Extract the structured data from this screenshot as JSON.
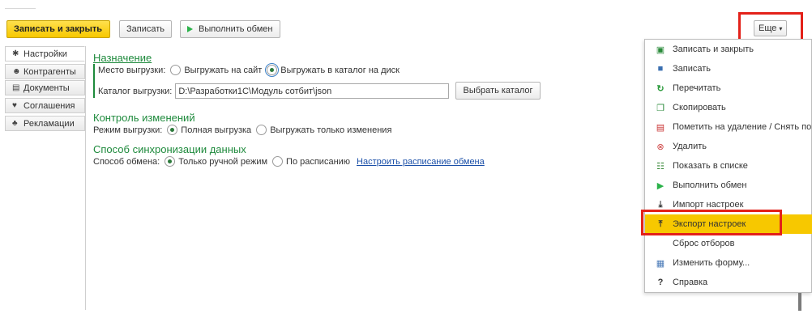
{
  "toolbar": {
    "save_close": "Записать и закрыть",
    "save": "Записать",
    "run_exchange": "Выполнить обмен",
    "more": "Еще"
  },
  "tabs": [
    {
      "label": "Настройки",
      "icon": "gear-icon"
    },
    {
      "label": "Контрагенты",
      "icon": "people-icon"
    },
    {
      "label": "Документы",
      "icon": "document-icon"
    },
    {
      "label": "Соглашения",
      "icon": "handshake-icon"
    },
    {
      "label": "Рекламации",
      "icon": "claims-icon"
    }
  ],
  "destination": {
    "title": "Назначение",
    "place_label": "Место выгрузки:",
    "option_site": "Выгружать на сайт",
    "option_disk": "Выгружать в каталог на диск",
    "folder_label": "Каталог выгрузки:",
    "folder_value": "D:\\Разработки1С\\Модуль сотбит\\json",
    "choose_folder": "Выбрать каталог"
  },
  "changes": {
    "title": "Контроль изменений",
    "mode_label": "Режим выгрузки:",
    "option_full": "Полная выгрузка",
    "option_changes": "Выгружать только изменения"
  },
  "sync": {
    "title": "Способ синхронизации данных",
    "method_label": "Способ обмена:",
    "option_manual": "Только ручной режим",
    "option_schedule": "По расписанию",
    "schedule_link": "Настроить расписание обмена"
  },
  "menu": {
    "items": [
      {
        "label": "Записать и закрыть",
        "icon": "save-close-icon"
      },
      {
        "label": "Записать",
        "icon": "save-icon"
      },
      {
        "label": "Перечитать",
        "icon": "refresh-icon"
      },
      {
        "label": "Скопировать",
        "icon": "copy-icon"
      },
      {
        "label": "Пометить на удаление / Снять по",
        "icon": "mark-delete-icon"
      },
      {
        "label": "Удалить",
        "icon": "delete-icon"
      },
      {
        "label": "Показать в списке",
        "icon": "show-in-list-icon"
      },
      {
        "label": "Выполнить обмен",
        "icon": "play-icon"
      },
      {
        "label": "Импорт настроек",
        "icon": "import-icon"
      },
      {
        "label": "Экспорт настроек",
        "icon": "export-icon",
        "highlighted": true
      },
      {
        "label": "Сброс отборов",
        "icon": ""
      },
      {
        "label": "Изменить форму...",
        "icon": "change-form-icon"
      },
      {
        "label": "Справка",
        "icon": "help-icon"
      }
    ]
  },
  "colors": {
    "accent_yellow": "#f7c800",
    "section_green": "#1e8a3c",
    "annotation_red": "#e32119",
    "link_blue": "#1a4fa8"
  }
}
